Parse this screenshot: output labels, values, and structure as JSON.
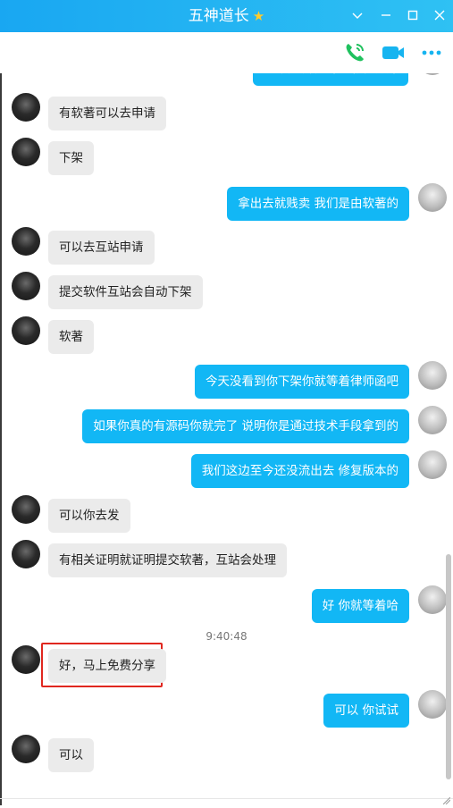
{
  "window": {
    "title": "五神道长",
    "badge_icon": "star-badge-icon"
  },
  "titlebar_controls": [
    "chevron-down-icon",
    "minimize-icon",
    "maximize-icon",
    "close-icon"
  ],
  "toolbar": [
    "voice-call-icon",
    "video-call-icon",
    "more-icon"
  ],
  "colors": {
    "accent": "#12b7f5",
    "incoming_bubble": "#ebebeb",
    "highlight": "#e0271f"
  },
  "messages": [
    {
      "side": "out",
      "text": "至今还没流出去 修复版本的",
      "partial": true
    },
    {
      "side": "in",
      "text": "有软著可以去申请"
    },
    {
      "side": "in",
      "text": "下架"
    },
    {
      "side": "out",
      "text": "拿出去就贱卖 我们是由软著的"
    },
    {
      "side": "in",
      "text": "可以去互站申请"
    },
    {
      "side": "in",
      "text": "提交软件互站会自动下架"
    },
    {
      "side": "in",
      "text": "软著"
    },
    {
      "side": "out",
      "text": "今天没看到你下架你就等着律师函吧"
    },
    {
      "side": "out",
      "text": "如果你真的有源码你就完了 说明你是通过技术手段拿到的"
    },
    {
      "side": "out",
      "text": "我们这边至今还没流出去 修复版本的"
    },
    {
      "side": "in",
      "text": "可以你去发"
    },
    {
      "side": "in",
      "text": "有相关证明就证明提交软著，互站会处理"
    },
    {
      "side": "out",
      "text": "好 你就等着哈"
    },
    {
      "side": "in",
      "text": "好，马上免费分享",
      "highlighted": true
    },
    {
      "side": "out",
      "text": "可以 你试试"
    },
    {
      "side": "in",
      "text": "可以"
    }
  ],
  "timestamp": "9:40:48"
}
